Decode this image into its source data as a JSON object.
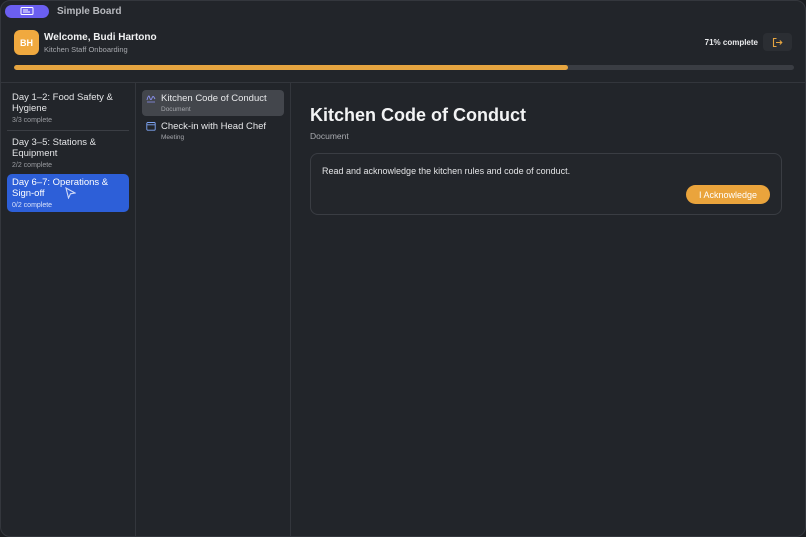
{
  "app": {
    "title": "Simple Board",
    "icon": "board-icon"
  },
  "header": {
    "avatar_initials": "BH",
    "welcome": "Welcome, Budi Hartono",
    "subtitle": "Kitchen Staff Onboarding",
    "progress_label": "71% complete",
    "progress_fraction": 0.71,
    "logout_icon": "logout-icon"
  },
  "stages": [
    {
      "title": "Day 1–2: Food Safety & Hygiene",
      "count": "3/3 complete"
    },
    {
      "title": "Day 3–5: Stations & Equipment",
      "count": "2/2 complete"
    },
    {
      "title": "Day 6–7: Operations & Sign-off",
      "count": "0/2 complete",
      "active": true
    }
  ],
  "tasks": [
    {
      "title": "Kitchen Code of Conduct",
      "type": "Document",
      "icon": "signature-icon",
      "active": true
    },
    {
      "title": "Check-in with Head Chef",
      "type": "Meeting",
      "icon": "calendar-icon"
    }
  ],
  "detail": {
    "title": "Kitchen Code of Conduct",
    "type": "Document",
    "description": "Read and acknowledge the kitchen rules and code of conduct.",
    "acknowledge_label": "I Acknowledge"
  },
  "colors": {
    "accent_orange": "#e6a540",
    "active_blue": "#2d5fd8",
    "app_purple": "#6b5ff0"
  }
}
